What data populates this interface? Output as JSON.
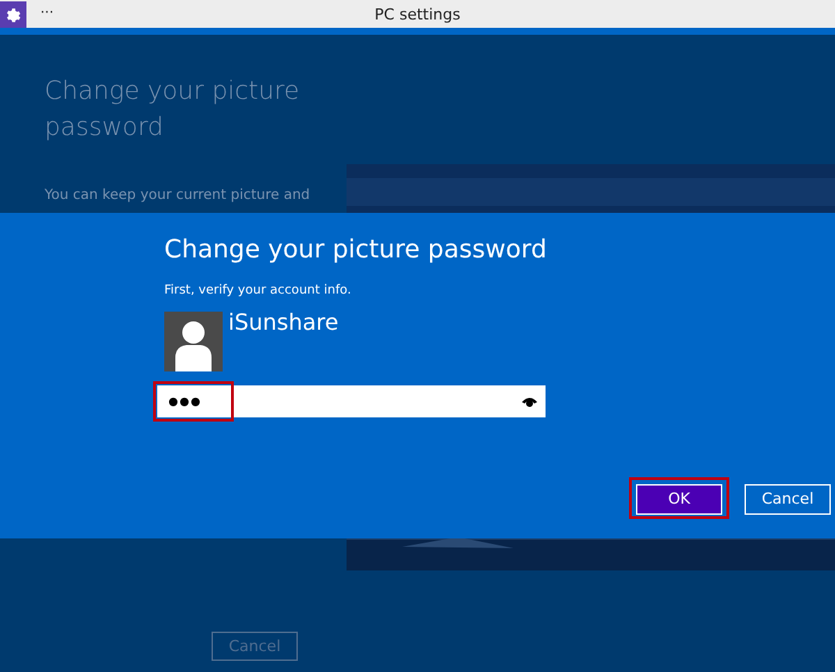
{
  "window": {
    "title": "PC settings",
    "menu": "···"
  },
  "page": {
    "title": "Change your picture password",
    "description": "You can keep your current picture and",
    "cancel_button": {
      "label": "Cancel",
      "disabled": true
    }
  },
  "dialog": {
    "title": "Change your picture password",
    "subtitle": "First, verify your account info.",
    "user_name": "iSunshare",
    "password": {
      "value": "●●●",
      "highlighted": true
    },
    "buttons": [
      {
        "label": "OK",
        "primary": true,
        "highlighted": true
      },
      {
        "label": "Cancel",
        "primary": false,
        "highlighted": false
      }
    ]
  }
}
